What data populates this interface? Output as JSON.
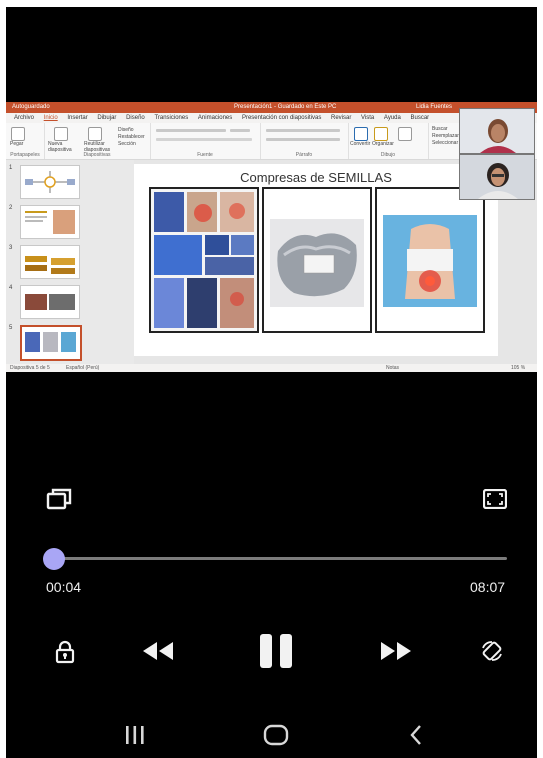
{
  "powerpoint": {
    "titlebar": {
      "autosave": "Autoguardado",
      "doc_title": "Presentación1 - Guardado en Este PC",
      "user": "Lidia Fuentes"
    },
    "menu": [
      "Archivo",
      "Inicio",
      "Insertar",
      "Dibujar",
      "Diseño",
      "Transiciones",
      "Animaciones",
      "Presentación con diapositivas",
      "Revisar",
      "Vista",
      "Ayuda",
      "Buscar"
    ],
    "ribbon_groups": [
      "Portapapeles",
      "Diapositivas",
      "Fuente",
      "Párrafo",
      "Dibujo",
      "Edición"
    ],
    "ribbon_buttons": {
      "paste": "Pegar",
      "new_slide": "Nueva diapositiva",
      "reuse": "Reutilizar diapositivas",
      "layout": "Diseño",
      "reset": "Restablecer",
      "section": "Sección",
      "convert": "Convertir",
      "arrange": "Organizar",
      "quick_styles": "Estilos rápidos",
      "find": "Buscar",
      "replace": "Reemplazar",
      "select": "Seleccionar"
    },
    "thumbnails": [
      "1",
      "2",
      "3",
      "4",
      "5"
    ],
    "active_slide": 5,
    "slide_title": "Compresas de SEMILLAS",
    "status": {
      "left": "Diapositiva 5 de 5",
      "language": "Español (Perú)",
      "notes": "Notas",
      "zoom": "105 %"
    }
  },
  "player": {
    "current_time": "00:04",
    "total_time": "08:07",
    "progress": 0.008
  },
  "colors": {
    "accent": "#a9a6f5",
    "ppt_brand": "#c4502b",
    "background": "#000000"
  },
  "icons": {
    "pip": "pip-icon",
    "fullscreen": "fullscreen-icon",
    "lock": "lock-icon",
    "rewind": "rewind-icon",
    "pause": "pause-icon",
    "fast_forward": "fast-forward-icon",
    "rotate": "rotate-icon",
    "nav_recents": "recents-icon",
    "nav_home": "home-icon",
    "nav_back": "back-icon"
  }
}
